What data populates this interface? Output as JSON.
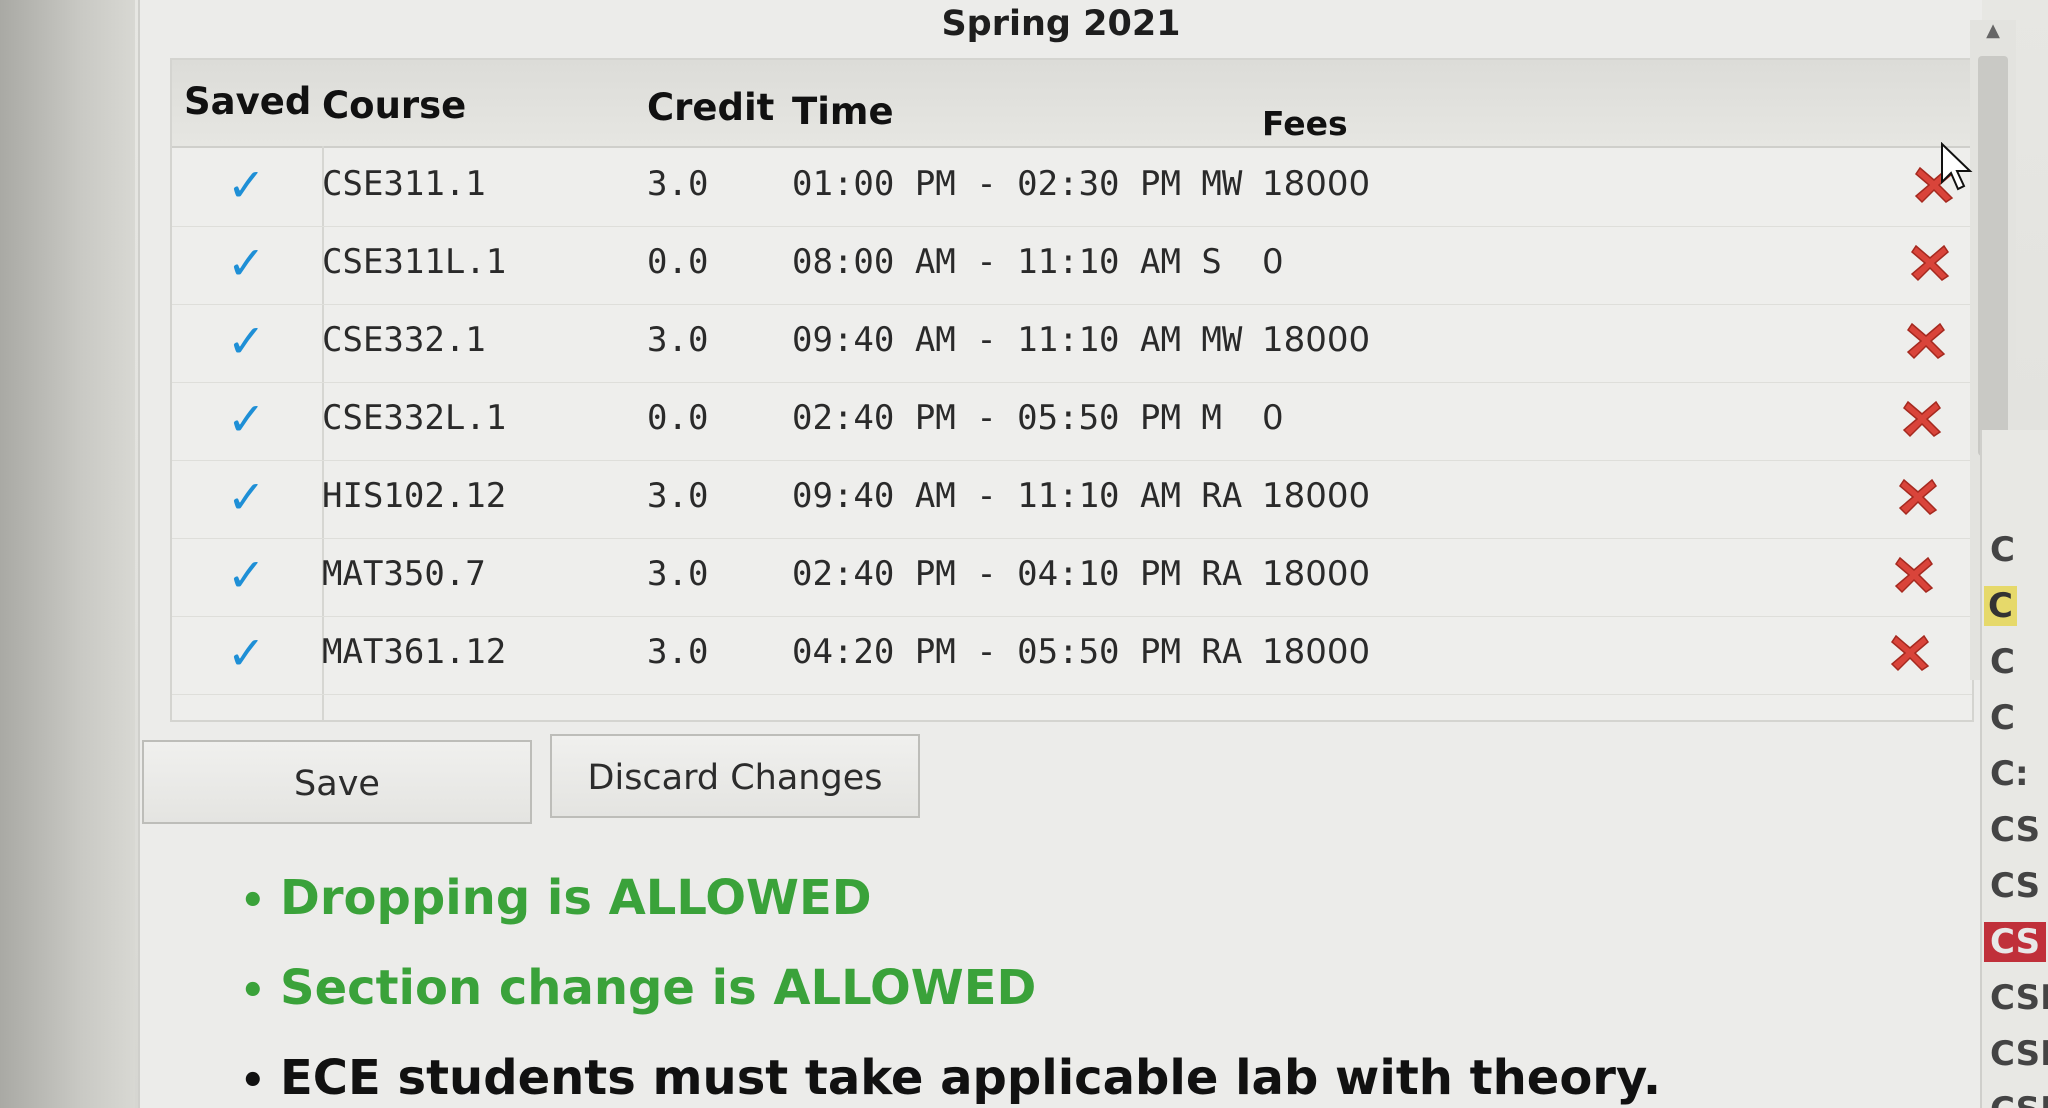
{
  "term": "Spring 2021",
  "table": {
    "headers": {
      "saved": "Saved",
      "course": "Course",
      "credit": "Credit",
      "time": "Time",
      "fees": "Fees"
    },
    "rows": [
      {
        "saved": "✓",
        "course": "CSE311.1",
        "credit": "3.0",
        "time": "01:00 PM - 02:30 PM MW",
        "fees": "18000"
      },
      {
        "saved": "✓",
        "course": "CSE311L.1",
        "credit": "0.0",
        "time": "08:00 AM - 11:10 AM S",
        "fees": "0"
      },
      {
        "saved": "✓",
        "course": "CSE332.1",
        "credit": "3.0",
        "time": "09:40 AM - 11:10 AM MW",
        "fees": "18000"
      },
      {
        "saved": "✓",
        "course": "CSE332L.1",
        "credit": "0.0",
        "time": "02:40 PM - 05:50 PM M",
        "fees": "0"
      },
      {
        "saved": "✓",
        "course": "HIS102.12",
        "credit": "3.0",
        "time": "09:40 AM - 11:10 AM RA",
        "fees": "18000"
      },
      {
        "saved": "✓",
        "course": "MAT350.7",
        "credit": "3.0",
        "time": "02:40 PM - 04:10 PM RA",
        "fees": "18000"
      },
      {
        "saved": "✓",
        "course": "MAT361.12",
        "credit": "3.0",
        "time": "04:20 PM - 05:50 PM RA",
        "fees": "18000"
      }
    ],
    "remove_icon": "remove-x-icon",
    "check_color": "#1e8fd6",
    "remove_color": "#d9443a"
  },
  "buttons": {
    "save": "Save",
    "discard": "Discard Changes"
  },
  "notes": [
    {
      "text": "Dropping is ALLOWED",
      "color": "#3aa23a"
    },
    {
      "text": "Section change is ALLOWED",
      "color": "#3aa23a"
    },
    {
      "text": "ECE students must take applicable lab with theory.",
      "color": "#111111"
    }
  ],
  "side_list": [
    "C",
    "C",
    "C",
    "C",
    "C:",
    "CS",
    "CS",
    "CS",
    "CSI",
    "CSE",
    "CSE"
  ]
}
